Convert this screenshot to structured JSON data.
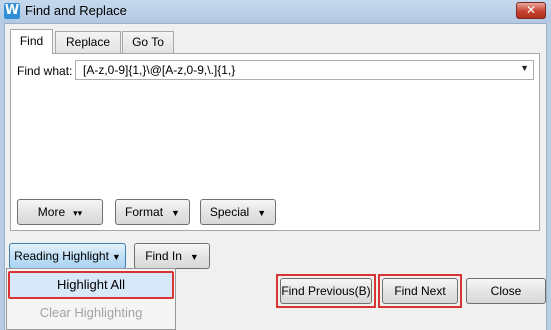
{
  "window": {
    "title": "Find and Replace",
    "close_glyph": "✕",
    "app_icon_glyph": "W"
  },
  "tabs": [
    {
      "label": "Find",
      "active": true
    },
    {
      "label": "Replace",
      "active": false
    },
    {
      "label": "Go To",
      "active": false
    }
  ],
  "find": {
    "label": "Find what:",
    "value": "[A-z,0-9]{1,}\\@[A-z,0-9,\\.]{1,}",
    "dropdown_glyph": "▼"
  },
  "options": {
    "more_label": "More",
    "more_glyph": "▾▾",
    "format_label": "Format",
    "special_label": "Special",
    "dropdown_glyph": "▼"
  },
  "bottom": {
    "reading_highlight_label": "Reading Highlight",
    "find_in_label": "Find In",
    "find_previous_label": "Find Previous(B)",
    "find_next_label": "Find Next",
    "close_label": "Close",
    "dropdown_glyph": "▼"
  },
  "menu": {
    "items": [
      {
        "label": "Highlight All",
        "enabled": true
      },
      {
        "label": "Clear Highlighting",
        "enabled": false
      }
    ]
  },
  "icons": [
    "app-icon",
    "close-icon",
    "chevron-down-icon",
    "double-chevron-down-icon"
  ],
  "colors": {
    "highlight_border": "#d83434",
    "title_bar": "#b9cde3",
    "accent_blue": "#2d8fd6"
  }
}
